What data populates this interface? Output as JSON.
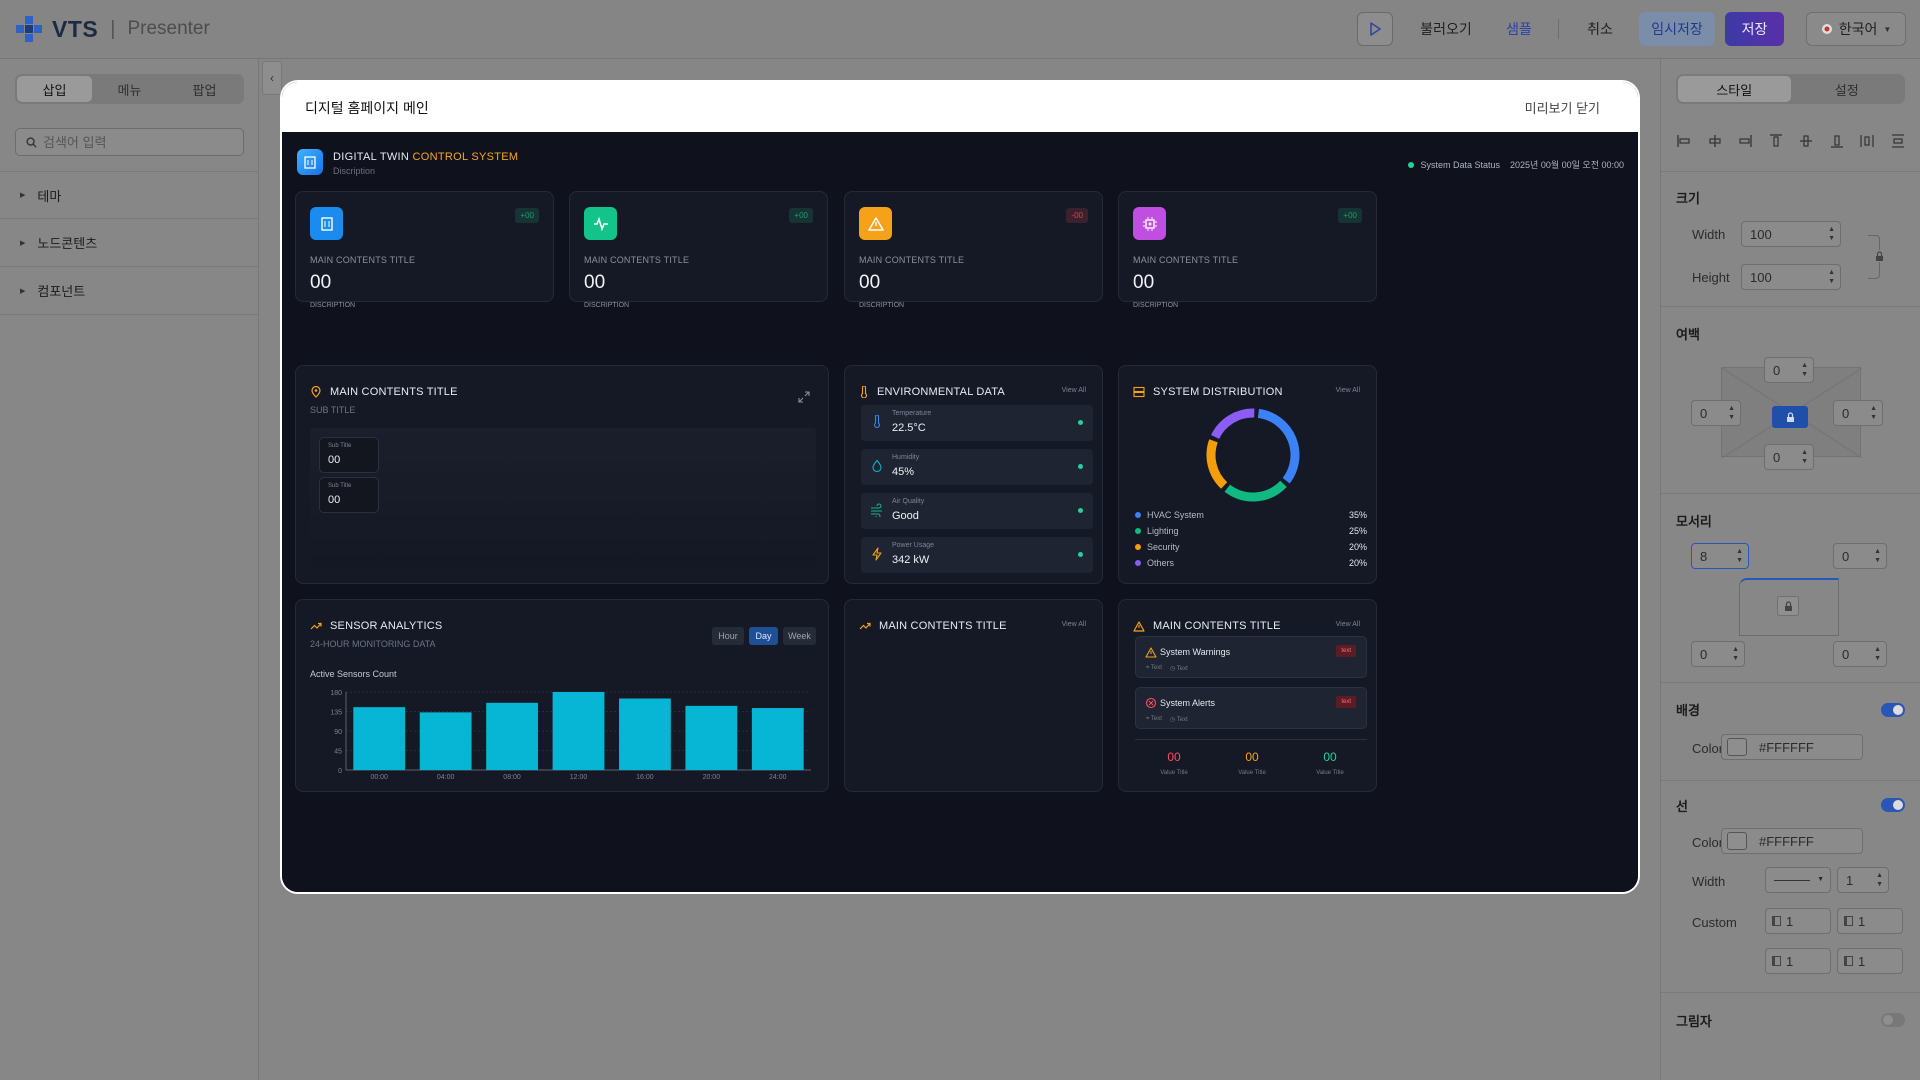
{
  "app": {
    "logo": "VTS",
    "name": "Presenter"
  },
  "toolbar": {
    "load": "불러오기",
    "sample": "샘플",
    "cancel": "취소",
    "temp_save": "임시저장",
    "save": "저장",
    "language": "한국어"
  },
  "left_panel": {
    "tabs": [
      "삽입",
      "메뉴",
      "팝업"
    ],
    "active_tab": 0,
    "search_placeholder": "검색어 입력",
    "tree": [
      "테마",
      "노드콘텐츠",
      "컴포넌트"
    ]
  },
  "right_panel": {
    "tabs": [
      "스타일",
      "설정"
    ],
    "active_tab": 0,
    "size": {
      "title": "크기",
      "width_label": "Width",
      "width": "100",
      "height_label": "Height",
      "height": "100"
    },
    "margin": {
      "title": "여백",
      "top": "0",
      "left": "0",
      "right": "0",
      "bottom": "0"
    },
    "corner": {
      "title": "모서리",
      "tl": "8",
      "tr": "0",
      "bl": "0",
      "br": "0"
    },
    "background": {
      "title": "배경",
      "color_label": "Color",
      "color": "#FFFFFF",
      "enabled": true
    },
    "line": {
      "title": "선",
      "color_label": "Color",
      "color": "#FFFFFF",
      "width_label": "Width",
      "width": "1",
      "custom_label": "Custom",
      "custom": [
        "1",
        "1",
        "1",
        "1"
      ],
      "enabled": true
    },
    "shadow": {
      "title": "그림자",
      "enabled": false
    }
  },
  "modal": {
    "title": "디지털 홈페이지 메인",
    "close": "미리보기 닫기"
  },
  "dashboard": {
    "header": {
      "title_a": "DIGITAL TWIN",
      "title_b": "CONTROL SYSTEM",
      "sub": "Discription",
      "status": "System Data Status",
      "datetime": "2025년 00월 00일 오전 00:00"
    },
    "stats": [
      {
        "badge": "+00",
        "label": "MAIN CONTENTS TITLE",
        "value": "00",
        "desc": "DISCRIPTION",
        "color": "#1a8cf0",
        "badge_color": "#1e9e6c",
        "icon": "building-icon"
      },
      {
        "badge": "+00",
        "label": "MAIN CONTENTS TITLE",
        "value": "00",
        "desc": "DISCRIPTION",
        "color": "#12c48a",
        "badge_color": "#1e9e6c",
        "icon": "pulse-icon"
      },
      {
        "badge": "-00",
        "label": "MAIN CONTENTS TITLE",
        "value": "00",
        "desc": "DISCRIPTION",
        "color": "#f5a21a",
        "badge_color": "#d94050",
        "icon": "warning-icon"
      },
      {
        "badge": "+00",
        "label": "MAIN CONTENTS TITLE",
        "value": "00",
        "desc": "DISCRIPTION",
        "color": "#c04ee0",
        "badge_color": "#1e9e6c",
        "icon": "chip-icon"
      }
    ],
    "map_card": {
      "title": "MAIN CONTENTS TITLE",
      "sub": "SUB TITLE",
      "items": [
        {
          "label": "Sub Title",
          "value": "00"
        },
        {
          "label": "Sub Title",
          "value": "00"
        }
      ]
    },
    "env": {
      "title": "ENVIRONMENTAL DATA",
      "view_all": "View All",
      "rows": [
        {
          "label": "Temperature",
          "value": "22.5°C",
          "icon": "thermometer-icon"
        },
        {
          "label": "Humidity",
          "value": "45%",
          "icon": "droplet-icon"
        },
        {
          "label": "Air Quality",
          "value": "Good",
          "icon": "wind-icon"
        },
        {
          "label": "Power Usage",
          "value": "342 kW",
          "icon": "bolt-icon"
        }
      ]
    },
    "distribution": {
      "title": "SYSTEM DISTRIBUTION",
      "view_all": "View All"
    },
    "sensor": {
      "title": "SENSOR ANALYTICS",
      "sub": "24-HOUR MONITORING DATA",
      "tabs": [
        "Hour",
        "Day",
        "Week"
      ],
      "active_tab": 1,
      "chart_label": "Active Sensors Count"
    },
    "blank_card": {
      "title": "MAIN CONTENTS TITLE",
      "view_all": "View All"
    },
    "alerts": {
      "title": "MAIN CONTENTS TITLE",
      "view_all": "View All",
      "items": [
        {
          "title": "System Warnings",
          "tag": "text",
          "meta1": "Text",
          "meta2": "Text",
          "icon": "warning-icon"
        },
        {
          "title": "System Alerts",
          "tag": "text",
          "meta1": "Text",
          "meta2": "Text",
          "icon": "alert-circle-icon"
        }
      ],
      "values": [
        {
          "value": "00",
          "label": "Value Title",
          "color": "#ff4d5e"
        },
        {
          "value": "00",
          "label": "Value Title",
          "color": "#f5a21a"
        },
        {
          "value": "00",
          "label": "Value Title",
          "color": "#1fd39b"
        }
      ]
    }
  },
  "chart_data": [
    {
      "type": "pie",
      "title": "SYSTEM DISTRIBUTION",
      "categories": [
        "HVAC System",
        "Lighting",
        "Security",
        "Others"
      ],
      "values": [
        35,
        25,
        20,
        20
      ],
      "labels": [
        "35%",
        "25%",
        "20%",
        "20%"
      ],
      "colors": [
        "#3b82f6",
        "#10b981",
        "#f59e0b",
        "#8b5cf6"
      ],
      "legend": "bottom"
    },
    {
      "type": "bar",
      "title": "Active Sensors Count",
      "categories": [
        "00:00",
        "04:00",
        "08:00",
        "12:00",
        "16:00",
        "20:00",
        "24:00"
      ],
      "values": [
        145,
        133,
        155,
        180,
        165,
        148,
        143
      ],
      "ylim": [
        0,
        180
      ],
      "yticks": [
        0,
        45,
        90,
        135,
        180
      ],
      "color": "#06b6d4",
      "grid": true
    }
  ]
}
